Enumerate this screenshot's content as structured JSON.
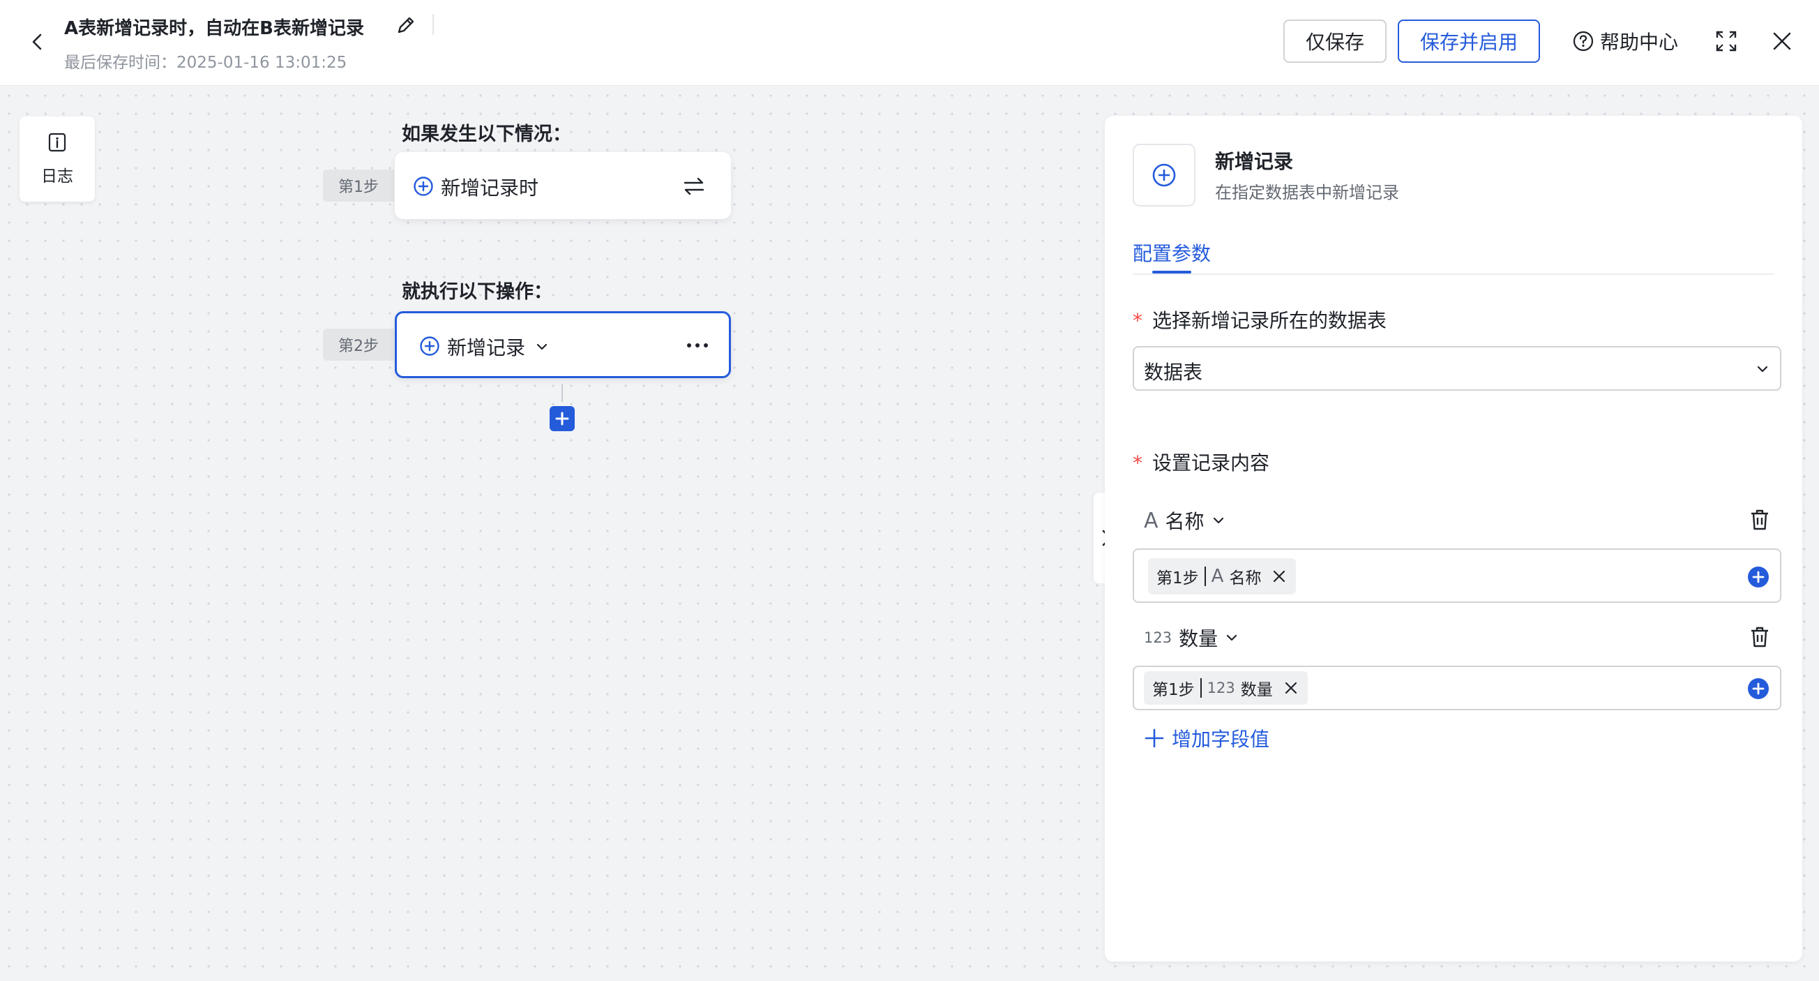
{
  "header": {
    "title": "A表新增记录时，自动在B表新增记录",
    "last_saved_label": "最后保存时间：",
    "last_saved_time": "2025-01-16 13:01:25",
    "save_only_label": "仅保存",
    "save_enable_label": "保存并启用",
    "help_label": "帮助中心"
  },
  "sidebar": {
    "log_label": "日志"
  },
  "flow": {
    "trigger_heading": "如果发生以下情况：",
    "action_heading": "就执行以下操作：",
    "steps": [
      {
        "tag": "第1步",
        "label": "新增记录时"
      },
      {
        "tag": "第2步",
        "label": "新增记录"
      }
    ]
  },
  "panel": {
    "title": "新增记录",
    "subtitle": "在指定数据表中新增记录",
    "tab": "配置参数",
    "table_field_label": "选择新增记录所在的数据表",
    "table_select_value": "数据表",
    "content_label": "设置记录内容",
    "fields": [
      {
        "type_glyph": "A",
        "name": "名称",
        "chip_step": "第1步",
        "chip_type": "A",
        "chip_name": "名称"
      },
      {
        "type_glyph": "123",
        "name": "数量",
        "chip_step": "第1步",
        "chip_type": "123",
        "chip_name": "数量"
      }
    ],
    "add_field_label": "增加字段值"
  },
  "colors": {
    "accent": "#245bdb",
    "required": "#f54a45",
    "text": "#1f2329",
    "muted": "#8f959e"
  }
}
